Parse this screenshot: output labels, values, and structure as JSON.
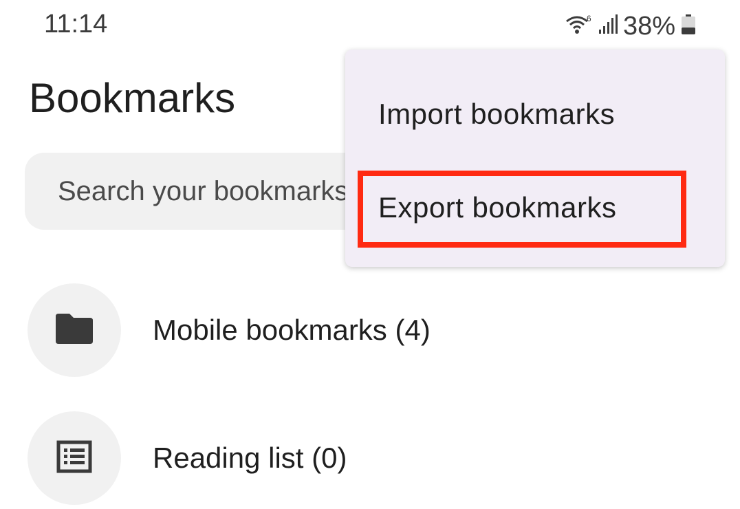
{
  "status_bar": {
    "time": "11:14",
    "battery_percent": "38%",
    "battery_level": 0.38,
    "icons": [
      "wifi-6-icon",
      "signal-icon",
      "battery-icon"
    ]
  },
  "header": {
    "title": "Bookmarks"
  },
  "search": {
    "placeholder": "Search your bookmarks"
  },
  "list": {
    "items": [
      {
        "label": "Mobile bookmarks (4)",
        "icon": "folder-icon"
      },
      {
        "label": "Reading list (0)",
        "icon": "reading-list-icon"
      }
    ]
  },
  "menu": {
    "items": [
      {
        "label": "Import bookmarks"
      },
      {
        "label": "Export bookmarks"
      }
    ],
    "highlighted_index": 1
  },
  "colors": {
    "highlight": "#ff2a12",
    "menu_bg": "#f2edf6",
    "surface": "#f1f1f1",
    "icon": "#3a3a3a"
  }
}
